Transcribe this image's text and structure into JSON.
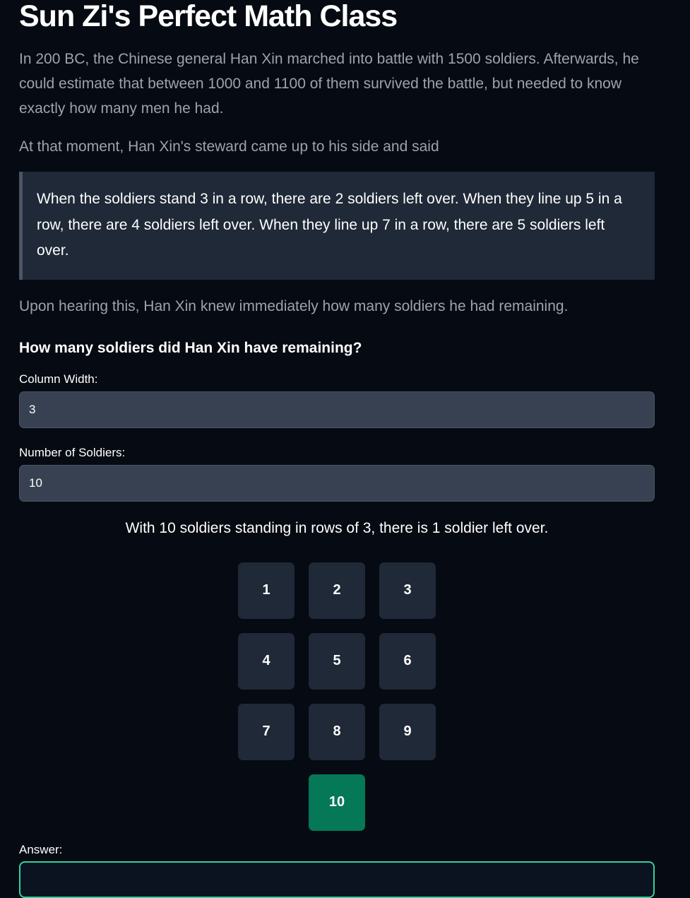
{
  "page": {
    "title": "Sun Zi's Perfect Math Class",
    "intro": "In 200 BC, the Chinese general Han Xin marched into battle with 1500 soldiers. Afterwards, he could estimate that between 1000 and 1100 of them survived the battle, but needed to know exactly how many men he had.",
    "para2": "At that moment, Han Xin's steward came up to his side and said",
    "quote": "When the soldiers stand 3 in a row, there are 2 soldiers left over. When they line up 5 in a row, there are 4 soldiers left over. When they line up 7 in a row, there are 5 soldiers left over.",
    "para3": "Upon hearing this, Han Xin knew immediately how many soldiers he had remaining.",
    "question": "How many soldiers did Han Xin have remaining?"
  },
  "form": {
    "column_width_label": "Column Width:",
    "column_width_value": "3",
    "soldiers_label": "Number of Soldiers:",
    "soldiers_value": "10",
    "answer_label": "Answer:",
    "answer_value": ""
  },
  "result_text": "With 10 soldiers standing in rows of 3, there is 1 soldier left over.",
  "soldiers": [
    "1",
    "2",
    "3",
    "4",
    "5",
    "6",
    "7",
    "8",
    "9",
    "10"
  ],
  "leftover_cells": [
    "10"
  ],
  "colors": {
    "background": "#060a12",
    "cell": "#1f2937",
    "leftover_cell": "#047857",
    "input": "#374151",
    "answer_border": "#34d399"
  }
}
